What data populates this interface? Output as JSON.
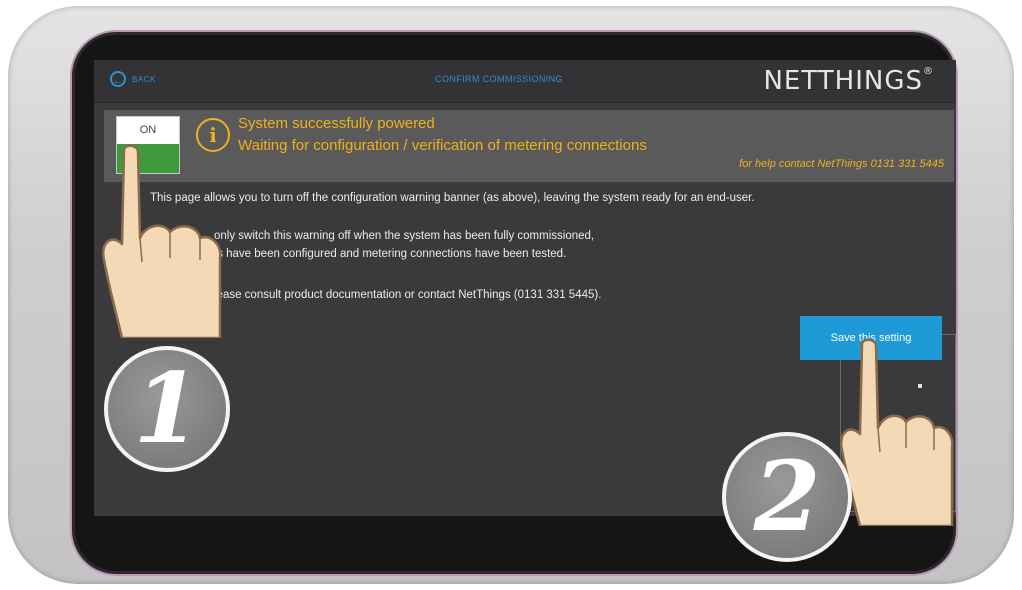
{
  "header": {
    "back_label": "BACK",
    "title": "CONFIRM COMMISSIONING",
    "logo": "NETTHINGS",
    "logo_mark": "®"
  },
  "banner": {
    "toggle_label": "ON",
    "info_glyph": "i",
    "line1": "System successfully powered",
    "line2": "Waiting for configuration / verification of metering connections",
    "help": "for help contact NetThings 0131 331 5445"
  },
  "body": {
    "p1": "This page allows you to turn off the configuration warning banner (as above), leaving the system ready for an end-user.",
    "p2a": "only switch this warning off when the system has been fully commissioned,",
    "p2b": "ts have been configured and metering connections have been tested.",
    "p3": "lease consult product documentation or contact NetThings (0131 331 5445).",
    "save_label": "Save this setting"
  },
  "steps": {
    "one": "1",
    "two": "2"
  },
  "colors": {
    "accent_blue": "#1e9ad6",
    "warning_yellow": "#f0b01c",
    "toggle_green": "#3f9a3b",
    "screen_bg": "#3a3a3c"
  },
  "icons": [
    "back-arrow-icon",
    "info-icon",
    "pointing-hand-icon"
  ]
}
